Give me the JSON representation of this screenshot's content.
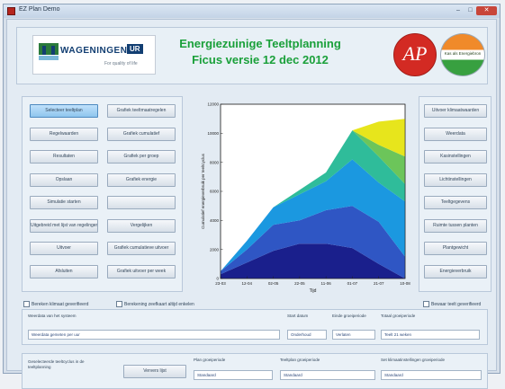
{
  "window": {
    "title": "EZ Plan Demo"
  },
  "window_controls": {
    "minimize": "–",
    "maximize": "□",
    "close": "✕"
  },
  "header": {
    "title_line1": "Energiezuinige Teeltplanning",
    "title_line2": "Ficus versie 12 dec 2012",
    "logo_wur_name": "WAGENINGEN",
    "logo_wur_suffix": "UR",
    "logo_wur_tagline": "For quality of life",
    "logo_ap": "AP",
    "logo_green": "Kas als Energiebron"
  },
  "left_buttons": [
    [
      "Selecteer teeltplan",
      "Grafiek teeltmaatregelen"
    ],
    [
      "Regelwaarden",
      "Grafiek cumulatief"
    ],
    [
      "Resultaten",
      "Grafiek per groep"
    ],
    [
      "Opslaan",
      "Grafiek energie"
    ],
    [
      "Simulatie starten",
      ""
    ],
    [
      "Uitgebreid met lijst van regelingen",
      "Vergelijken"
    ],
    [
      "Uitvoer",
      "Grafiek cumulatieve uitvoer"
    ],
    [
      "Afsluiten",
      "Grafiek uitvoer per week"
    ]
  ],
  "right_buttons": [
    "Uitvoer klimaatwaarden",
    "Weerdata",
    "Kasinstellingen",
    "Lichtinstellingen",
    "Teeltgegevens",
    "Ruimte tussen planten",
    "Plantgewicht",
    "Energieverbruik"
  ],
  "chart_data": {
    "type": "area",
    "x": [
      "23-03",
      "12-04",
      "02-05",
      "22-05",
      "11-06",
      "01-07",
      "21-07",
      "10-08"
    ],
    "xlabel": "Tijd",
    "ylabel": "Cumulatief energieverbruik per teeltcyclus",
    "ylim": [
      0,
      12000
    ],
    "yticks": [
      0,
      2000,
      4000,
      6000,
      8000,
      10000,
      12000
    ],
    "grid": false,
    "series": [
      {
        "color": "#1a1f8c",
        "values": [
          300,
          1100,
          1900,
          2400,
          2400,
          2100,
          1000,
          0
        ]
      },
      {
        "color": "#2f56c4",
        "values": [
          200,
          900,
          1800,
          1600,
          2300,
          2900,
          2900,
          1500
        ]
      },
      {
        "color": "#1b98e0",
        "values": [
          0,
          600,
          1200,
          1800,
          2000,
          3200,
          2700,
          3800
        ]
      },
      {
        "color": "#2fbc9a",
        "values": [
          0,
          0,
          0,
          300,
          600,
          2000,
          1800,
          1200
        ]
      },
      {
        "color": "#6cc55a",
        "values": [
          0,
          0,
          0,
          0,
          0,
          0,
          800,
          1900
        ]
      },
      {
        "color": "#e7e51c",
        "values": [
          0,
          0,
          0,
          0,
          0,
          0,
          1600,
          2600
        ]
      }
    ]
  },
  "checkboxes": {
    "left": "Bereken klimaat geverifieerd",
    "middle": "Berekening zeefkaart altijd enkelen",
    "right": "Bewaar teelt geverifieerd"
  },
  "panel_a": {
    "label_system": "Weerdata van het systeem",
    "value_system": "Weerdata gemeten per uur",
    "label_start": "Start datum",
    "value_start": "Onderhoud",
    "label_end": "Einde groeiperiode",
    "value_end": "Verlaten",
    "label_total": "Totaal groeiperiode",
    "value_total": "Teelt 21 weken"
  },
  "panel_b": {
    "label_info": "Geselecteerde teeltcyclus in de teeltplanning",
    "button": "Ververs lijst",
    "label_f1": "Plan groeiperiode",
    "value_f1": "Standaard",
    "label_f2": "Teeltplan groeiperiode",
    "value_f2": "Standaard",
    "label_f3": "Set klimaatinstellingen groeiperiode",
    "value_f3": "Standaard"
  }
}
